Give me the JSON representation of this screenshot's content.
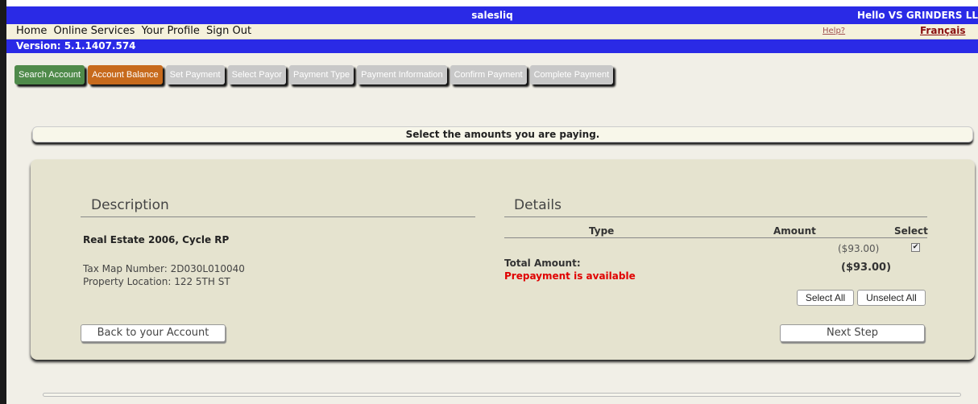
{
  "header": {
    "app_title": "salesliq",
    "greeting": "Hello VS GRINDERS LL"
  },
  "nav": {
    "items": [
      "Home",
      "Online Services",
      "Your Profile",
      "Sign Out"
    ],
    "help": "Help?",
    "language": "Français"
  },
  "version": "Version: 5.1.1407.574",
  "steps": [
    {
      "label": "Search Account",
      "state": "completed",
      "color": "#4f8a4a"
    },
    {
      "label": "Account Balance",
      "state": "current",
      "color": "#c76a1c"
    },
    {
      "label": "Set Payment",
      "state": "disabled"
    },
    {
      "label": "Select Payor",
      "state": "disabled"
    },
    {
      "label": "Payment Type",
      "state": "disabled"
    },
    {
      "label": "Payment Information",
      "state": "disabled"
    },
    {
      "label": "Confirm Payment",
      "state": "disabled"
    },
    {
      "label": "Complete Payment",
      "state": "disabled"
    }
  ],
  "instruction": "Select the amounts you are paying.",
  "description": {
    "heading": "Description",
    "title": "Real Estate 2006, Cycle RP",
    "tax_map": "Tax Map Number: 2D030L010040",
    "location": "Property Location: 122 5TH ST"
  },
  "details": {
    "heading": "Details",
    "columns": {
      "type": "Type",
      "amount": "Amount",
      "select": "Select"
    },
    "row_amount": "($93.00)",
    "row_selected": true,
    "total_label": "Total Amount:",
    "prepay_note": "Prepayment is available",
    "total_value": "($93.00)"
  },
  "buttons": {
    "select_all": "Select All",
    "unselect_all": "Unselect All",
    "back": "Back to your Account",
    "next": "Next Step"
  }
}
